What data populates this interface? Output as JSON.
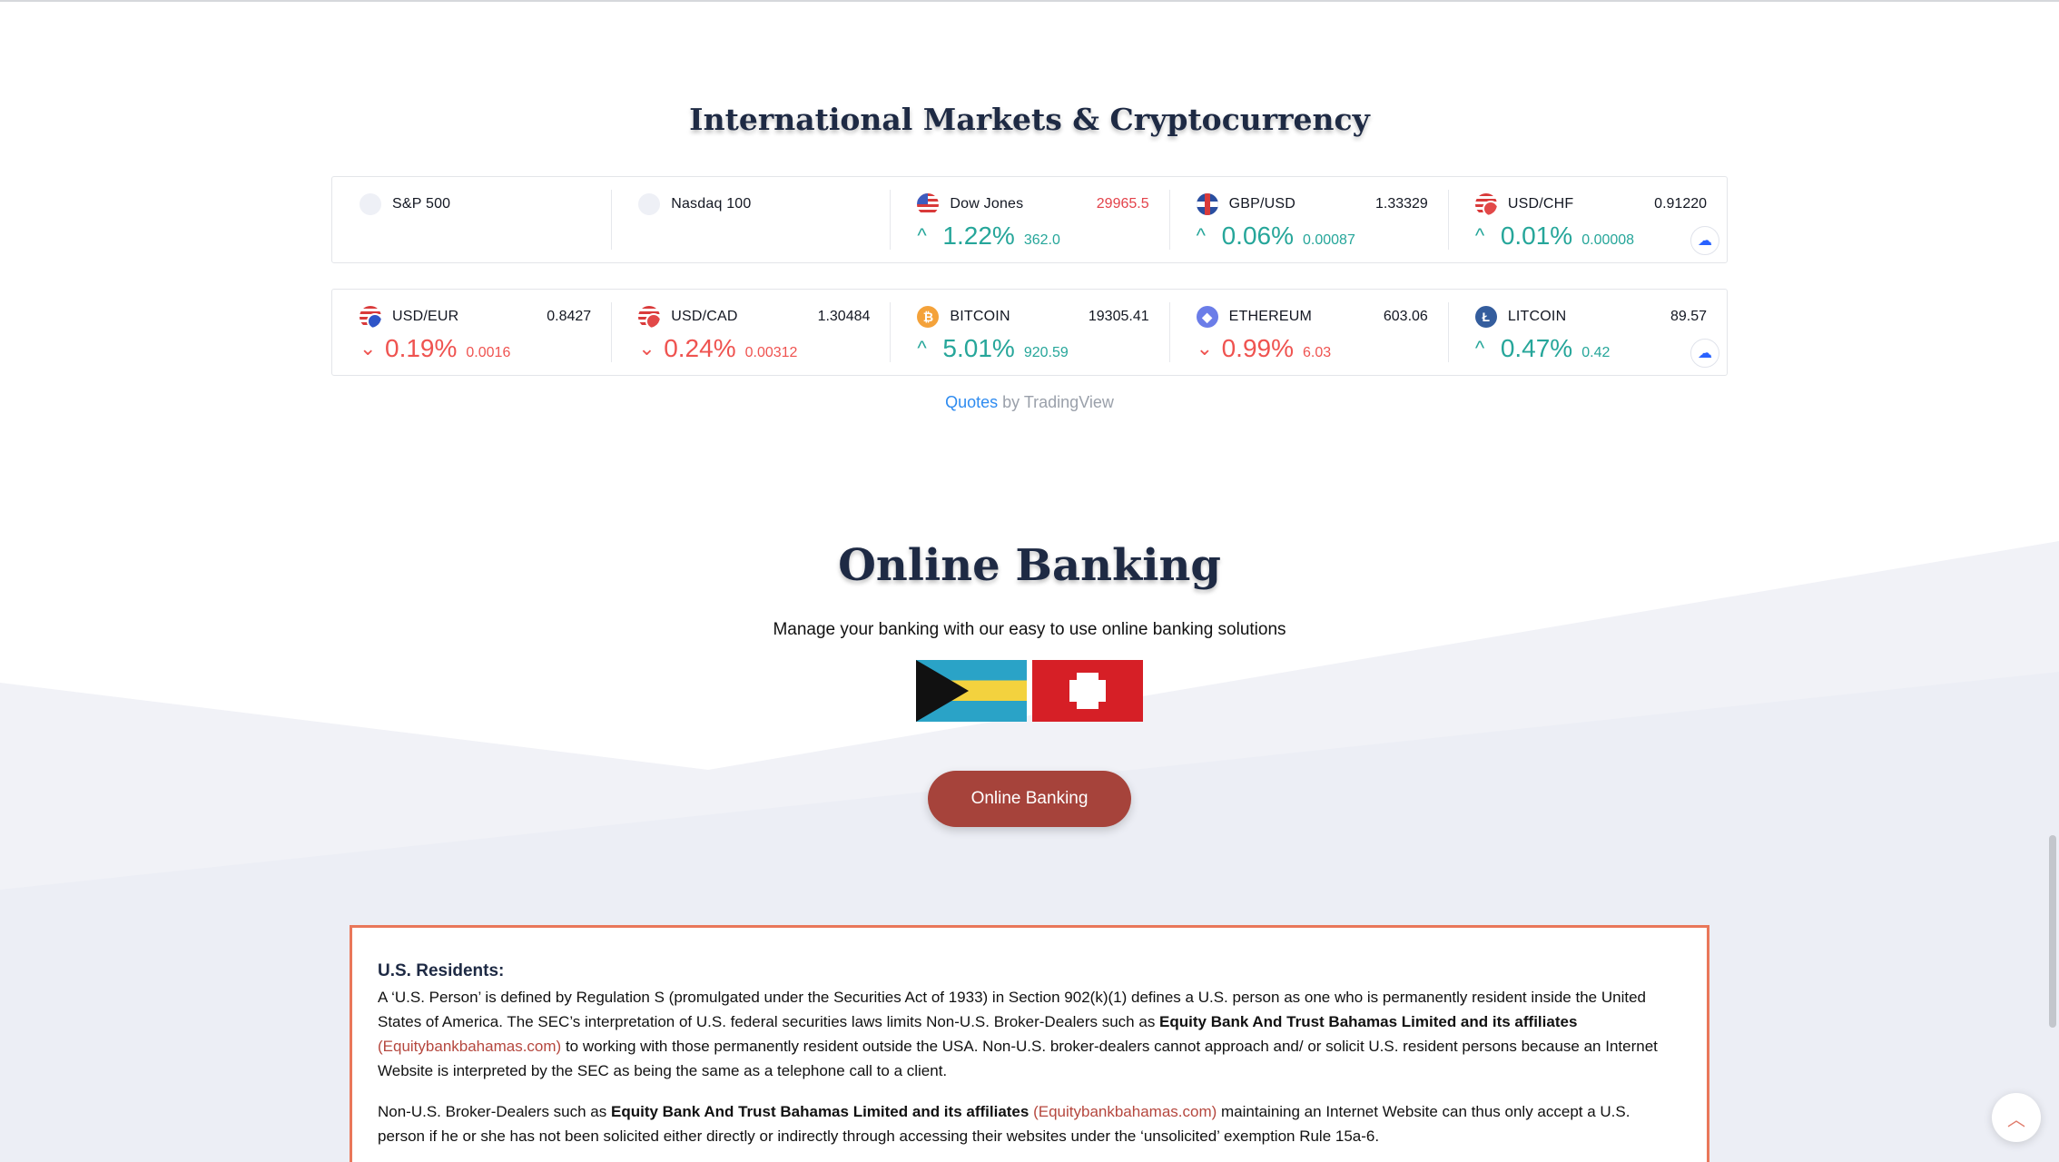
{
  "markets": {
    "title": "International Markets & Cryptocurrency",
    "row1": [
      {
        "name": "S&P 500",
        "logo": "blank-circle-icon"
      },
      {
        "name": "Nasdaq 100",
        "logo": "blank-circle-icon"
      },
      {
        "name": "Dow Jones",
        "price": "29965.5",
        "change_pct": "1.22%",
        "change_abs": "362.0",
        "direction": "up",
        "logo": "us-flag-icon"
      },
      {
        "name": "GBP/USD",
        "price": "1.33329",
        "change_pct": "0.06%",
        "change_abs": "0.00087",
        "direction": "up",
        "logo": "gb-flag-icon"
      },
      {
        "name": "USD/CHF",
        "price": "0.91220",
        "change_pct": "0.01%",
        "change_abs": "0.00008",
        "direction": "up",
        "logo": "us-ch-flag-icon"
      }
    ],
    "row2": [
      {
        "name": "USD/EUR",
        "price": "0.8427",
        "change_pct": "0.19%",
        "change_abs": "0.0016",
        "direction": "down",
        "logo": "us-eu-flag-icon"
      },
      {
        "name": "USD/CAD",
        "price": "1.30484",
        "change_pct": "0.24%",
        "change_abs": "0.00312",
        "direction": "down",
        "logo": "us-ca-flag-icon"
      },
      {
        "name": "BITCOIN",
        "price": "19305.41",
        "change_pct": "5.01%",
        "change_abs": "920.59",
        "direction": "up",
        "logo": "bitcoin-icon"
      },
      {
        "name": "ETHEREUM",
        "price": "603.06",
        "change_pct": "0.99%",
        "change_abs": "6.03",
        "direction": "down",
        "logo": "ethereum-icon"
      },
      {
        "name": "LITCOIN",
        "price": "89.57",
        "change_pct": "0.47%",
        "change_abs": "0.42",
        "direction": "up",
        "logo": "litecoin-icon"
      }
    ],
    "credit_link": "Quotes",
    "credit_by": " by TradingView"
  },
  "banking": {
    "title": "Online Banking",
    "subtitle": "Manage your banking with our easy to use online banking solutions",
    "button_label": "Online Banking",
    "flags": [
      "bahamas-flag",
      "switzerland-flag"
    ]
  },
  "notice": {
    "heading": "U.S. Residents:",
    "p1_a": "A ‘U.S. Person’ is defined by Regulation S (promulgated under the Securities Act of 1933) in Section 902(k)(1) defines a U.S. person as one who is permanently resident inside the United States of America. The SEC’s interpretation of U.S. federal securities laws limits Non-U.S. Broker-Dealers such as ",
    "p1_bold": "Equity Bank And Trust Bahamas Limited and its affiliates",
    "p1_link": "(Equitybankbahamas.com)",
    "p1_b": " to working with those permanently resident outside the USA. Non-U.S. broker-dealers cannot approach and/ or solicit U.S. resident persons because an Internet Website is interpreted by the SEC as being the same as a telephone call to a client.",
    "p2_a": "Non-U.S. Broker-Dealers such as ",
    "p2_bold": "Equity Bank And Trust Bahamas Limited and its affiliates",
    "p2_link": "(Equitybankbahamas.com)",
    "p2_b": " maintaining an Internet Website can thus only accept a U.S. person if he or she has not been solicited either directly or indirectly through accessing their websites under the ‘unsolicited’ exemption Rule 15a-6."
  },
  "colors": {
    "up": "#26a69a",
    "down": "#ef5350",
    "button": "#a6433b",
    "notice_border": "#e9775a",
    "title": "#1e2a44"
  }
}
